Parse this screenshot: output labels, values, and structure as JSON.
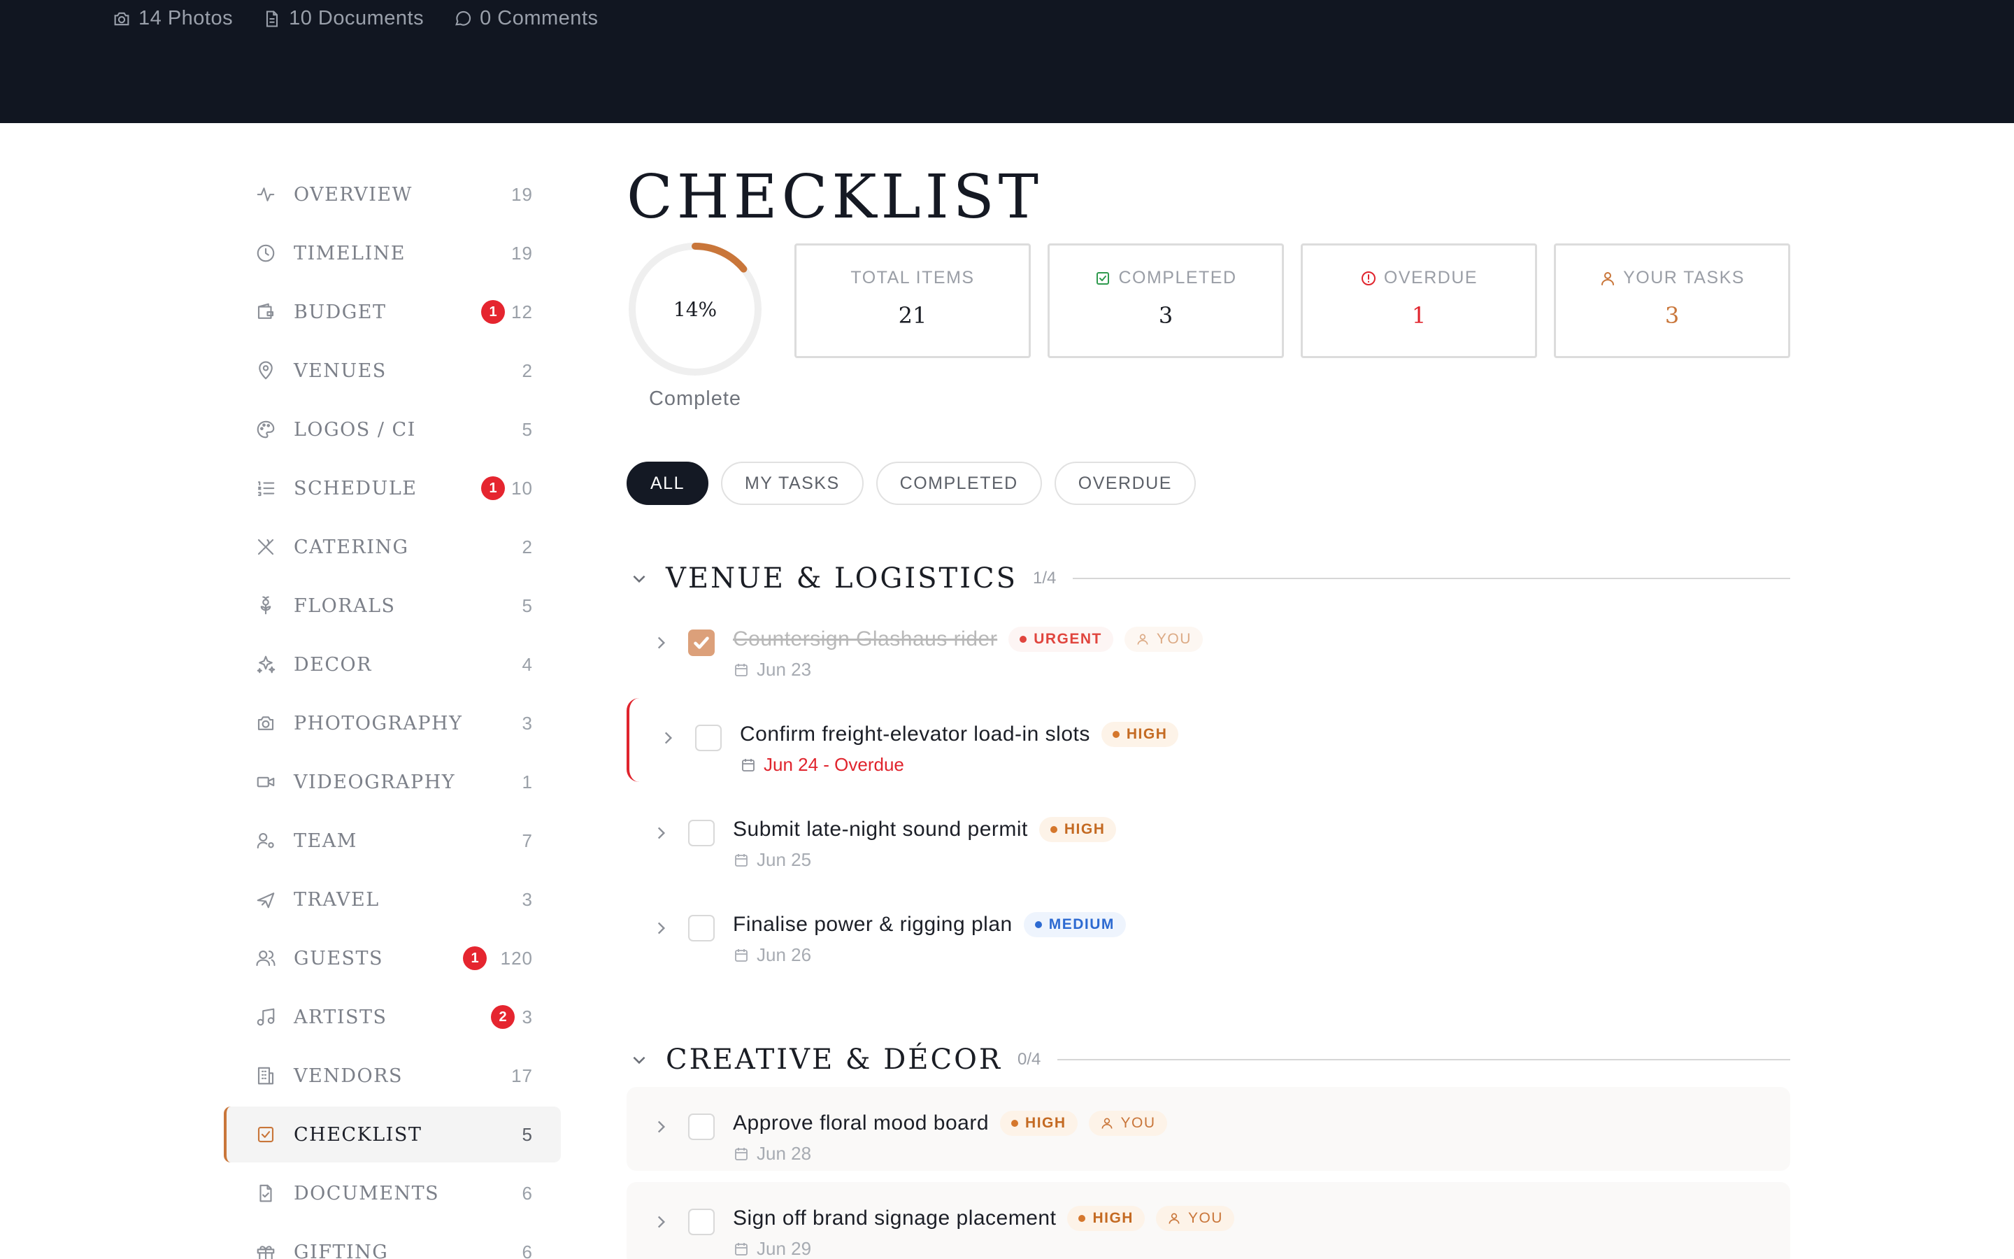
{
  "header": {
    "photos": "14 Photos",
    "documents": "10 Documents",
    "comments": "0 Comments"
  },
  "sidebar": {
    "items": [
      {
        "label": "Overview",
        "count": "19",
        "icon": "activity-icon"
      },
      {
        "label": "Timeline",
        "count": "19",
        "icon": "clock-icon"
      },
      {
        "label": "Budget",
        "count": "12",
        "badge": "1",
        "icon": "wallet-icon"
      },
      {
        "label": "Venues",
        "count": "2",
        "icon": "map-pin-icon"
      },
      {
        "label": "Logos / CI",
        "count": "5",
        "icon": "palette-icon"
      },
      {
        "label": "Schedule",
        "count": "10",
        "badge": "1",
        "icon": "list-ordered-icon"
      },
      {
        "label": "Catering",
        "count": "2",
        "icon": "utensils-crossed-icon"
      },
      {
        "label": "Florals",
        "count": "5",
        "icon": "flower-icon"
      },
      {
        "label": "Decor",
        "count": "4",
        "icon": "sparkles-icon"
      },
      {
        "label": "Photography",
        "count": "3",
        "icon": "camera-icon"
      },
      {
        "label": "Videography",
        "count": "1",
        "icon": "video-icon"
      },
      {
        "label": "Team",
        "count": "7",
        "icon": "user-cog-icon"
      },
      {
        "label": "Travel",
        "count": "3",
        "icon": "plane-icon"
      },
      {
        "label": "Guests",
        "count": "120",
        "badge": "1",
        "icon": "users-icon"
      },
      {
        "label": "Artists",
        "count": "3",
        "badge": "2",
        "icon": "music-icon"
      },
      {
        "label": "Vendors",
        "count": "17",
        "icon": "building-icon"
      },
      {
        "label": "Checklist",
        "count": "5",
        "icon": "check-square-icon",
        "active": true
      },
      {
        "label": "Documents",
        "count": "6",
        "icon": "file-check-icon"
      },
      {
        "label": "Gifting",
        "count": "6",
        "icon": "gift-icon"
      }
    ]
  },
  "main": {
    "title": "Checklist",
    "progress": {
      "percent": 14,
      "label": "14%",
      "caption": "Complete"
    },
    "stats": [
      {
        "label": "Total Items",
        "value": "21",
        "color": "#1a1d24",
        "icon": ""
      },
      {
        "label": "Completed",
        "value": "3",
        "color": "#1a1d24",
        "icon": "check-square-icon",
        "icon_color": "#2f9a4e"
      },
      {
        "label": "Overdue",
        "value": "1",
        "color": "#e0242d",
        "icon": "alert-circle-icon",
        "icon_color": "#e0242d"
      },
      {
        "label": "Your Tasks",
        "value": "3",
        "color": "#c9763a",
        "icon": "user-icon",
        "icon_color": "#c9763a"
      }
    ],
    "filters": [
      {
        "label": "All",
        "active": true
      },
      {
        "label": "My Tasks",
        "active": false
      },
      {
        "label": "Completed",
        "active": false
      },
      {
        "label": "Overdue",
        "active": false
      }
    ],
    "sections": [
      {
        "title": "Venue & Logistics",
        "count": "1/4",
        "tasks": [
          {
            "title": "Countersign Glashaus rider",
            "date": "Jun 23",
            "done": true,
            "tags": [
              {
                "type": "urgent",
                "label": "Urgent"
              },
              {
                "type": "you",
                "label": "You"
              }
            ]
          },
          {
            "title": "Confirm freight-elevator load-in slots",
            "date": "Jun 24 - Overdue",
            "overdue": true,
            "tags": [
              {
                "type": "high",
                "label": "High"
              }
            ]
          },
          {
            "title": "Submit late-night sound permit",
            "date": "Jun 25",
            "tags": [
              {
                "type": "high",
                "label": "High"
              }
            ]
          },
          {
            "title": "Finalise power & rigging plan",
            "date": "Jun 26",
            "tags": [
              {
                "type": "medium",
                "label": "Medium"
              }
            ]
          }
        ]
      },
      {
        "title": "Creative & Décor",
        "count": "0/4",
        "tasks": [
          {
            "title": "Approve floral mood board",
            "date": "Jun 28",
            "tags": [
              {
                "type": "high",
                "label": "High"
              },
              {
                "type": "you",
                "label": "You"
              }
            ]
          },
          {
            "title": "Sign off brand signage placement",
            "date": "Jun 29",
            "tags": [
              {
                "type": "high",
                "label": "High"
              },
              {
                "type": "you",
                "label": "You"
              }
            ]
          }
        ]
      }
    ]
  },
  "colors": {
    "accent": "#c9763a",
    "header_bg": "#111621",
    "overdue": "#e0242d",
    "badge": "#e5252f"
  }
}
